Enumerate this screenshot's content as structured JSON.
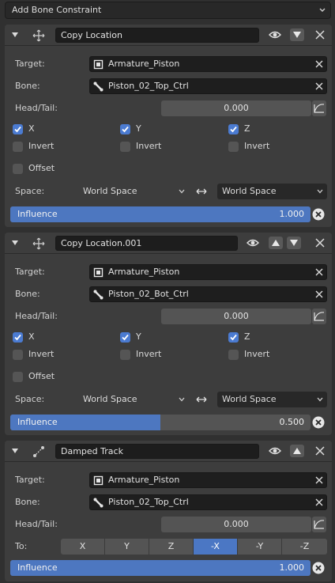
{
  "add_constraint": "Add Bone Constraint",
  "panels": [
    {
      "name": "Copy Location",
      "target_label": "Target:",
      "target": "Armature_Piston",
      "bone_label": "Bone:",
      "bone": "Piston_02_Top_Ctrl",
      "headtail_label": "Head/Tail:",
      "headtail": "0.000",
      "x": "X",
      "y": "Y",
      "z": "Z",
      "invert": "Invert",
      "offset": "Offset",
      "space_label": "Space:",
      "owner_space": "World Space",
      "target_space": "World Space",
      "influence_label": "Influence",
      "influence": "1.000",
      "influence_frac": 1.0
    },
    {
      "name": "Copy Location.001",
      "target_label": "Target:",
      "target": "Armature_Piston",
      "bone_label": "Bone:",
      "bone": "Piston_02_Bot_Ctrl",
      "headtail_label": "Head/Tail:",
      "headtail": "0.000",
      "x": "X",
      "y": "Y",
      "z": "Z",
      "invert": "Invert",
      "offset": "Offset",
      "space_label": "Space:",
      "owner_space": "World Space",
      "target_space": "World Space",
      "influence_label": "Influence",
      "influence": "0.500",
      "influence_frac": 0.5
    },
    {
      "name": "Damped Track",
      "target_label": "Target:",
      "target": "Armature_Piston",
      "bone_label": "Bone:",
      "bone": "Piston_02_Top_Ctrl",
      "headtail_label": "Head/Tail:",
      "headtail": "0.000",
      "to_label": "To:",
      "axes": [
        "X",
        "Y",
        "Z",
        "-X",
        "-Y",
        "-Z"
      ],
      "selected_axis": "-X",
      "influence_label": "Influence",
      "influence": "1.000",
      "influence_frac": 1.0
    }
  ],
  "colors": {
    "accent": "#4b7bd1",
    "panel": "#3d3d3d",
    "field": "#1e1e1e"
  }
}
